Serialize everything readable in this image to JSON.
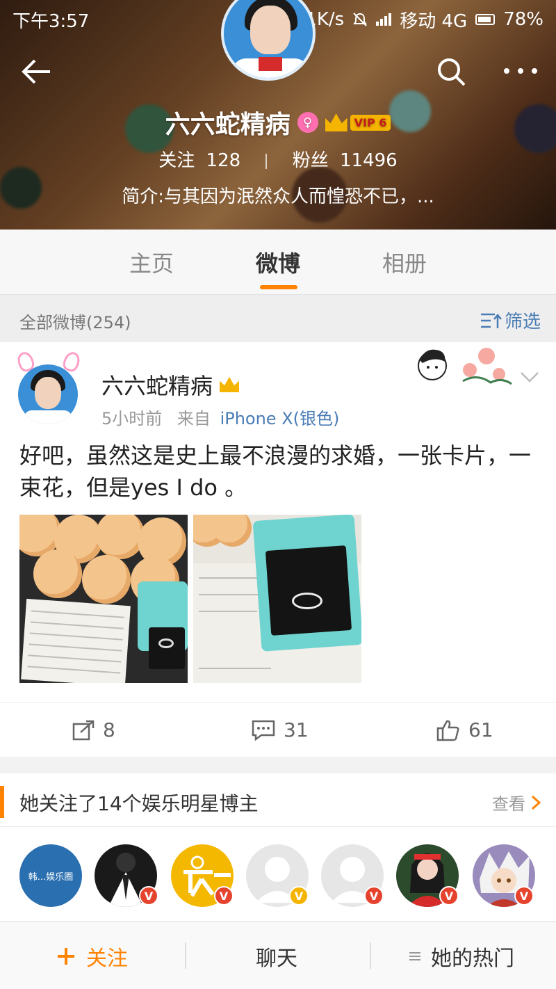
{
  "status_bar": {
    "time": "下午3:57",
    "dots": "...",
    "speed": "1.31K/s",
    "carrier": "移动 4G",
    "battery": "78%"
  },
  "header": {
    "profile_name": "六六蛇精病",
    "vip_label": "VIP 6",
    "gender_symbol": "♀",
    "following_label": "关注",
    "following_count": "128",
    "followers_label": "粉丝",
    "followers_count": "11496",
    "bio": "简介:与其因为泯然众人而惶恐不已，..."
  },
  "tabs": [
    {
      "label": "主页",
      "active": false
    },
    {
      "label": "微博",
      "active": true
    },
    {
      "label": "相册",
      "active": false
    }
  ],
  "filter_bar": {
    "all_posts": "全部微博(254)",
    "filter_label": "筛选"
  },
  "post": {
    "author": "六六蛇精病",
    "time": "5小时前",
    "source_prefix": "来自",
    "device": "iPhone X(银色)",
    "text": "好吧，虽然这是史上最不浪漫的求婚，一张卡片，一束花，但是yes I do 。",
    "repost_count": "8",
    "comment_count": "31",
    "like_count": "61"
  },
  "following": {
    "title": "她关注了14个娱乐明星博主",
    "view_label": "查看",
    "avatar1_text": "韩...娱乐圈"
  },
  "bottom_bar": {
    "follow_label": "关注",
    "chat_label": "聊天",
    "hot_label": "她的热门"
  },
  "colors": {
    "accent": "#ff8200",
    "link": "#4a7cb5",
    "vip_gold": "#f5b400"
  }
}
